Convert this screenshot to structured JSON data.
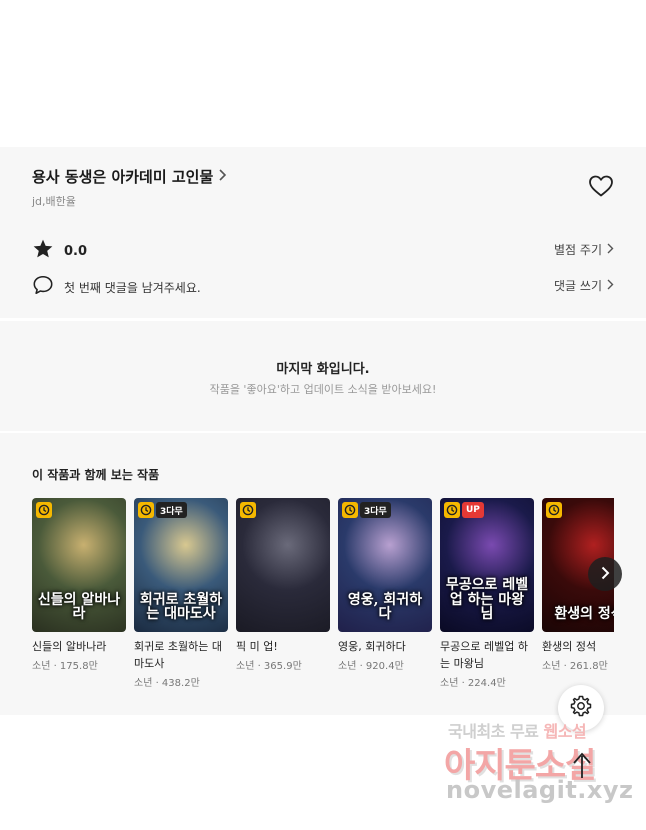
{
  "series": {
    "title": "용사 동생은 아카데미 고인물",
    "author": "jd,배한율"
  },
  "rating": {
    "value": "0.0",
    "rate_label": "별점 주기"
  },
  "comments": {
    "prompt": "첫 번째 댓글을 남겨주세요.",
    "write_label": "댓글 쓰기"
  },
  "last_episode": {
    "title": "마지막 화입니다.",
    "subtitle": "작품을 '좋아요'하고 업데이트 소식을 받아보세요!"
  },
  "recommendations": {
    "heading": "이 작품과 함께 보는 작품",
    "items": [
      {
        "name": "신들의 알바나라",
        "meta": "소년 · 175.8만",
        "badge": "",
        "cover_text": "신들의 알바나라",
        "colors": [
          "#4a5a3a",
          "#c8b070",
          "#2a3020"
        ]
      },
      {
        "name": "회귀로 초월하는 대마도사",
        "meta": "소년 · 438.2만",
        "badge": "3다무",
        "cover_text": "회귀로 초월하는 대마도사",
        "colors": [
          "#3a5a7a",
          "#d8c890",
          "#1a2a40"
        ]
      },
      {
        "name": "픽 미 업!",
        "meta": "소년 · 365.9만",
        "badge": "",
        "cover_text": "",
        "colors": [
          "#2a2a3a",
          "#6a6a7a",
          "#1a1a24"
        ]
      },
      {
        "name": "영웅, 회귀하다",
        "meta": "소년 · 920.4만",
        "badge": "3다무",
        "cover_text": "영웅, 회귀하다",
        "colors": [
          "#2a3a6a",
          "#b8a0d0",
          "#20204a"
        ]
      },
      {
        "name": "무공으로 레벨업 하는 마왕님",
        "meta": "소년 · 224.4만",
        "badge": "UP",
        "cover_text": "무공으로 레벨업 하는 마왕님",
        "colors": [
          "#1a1a4a",
          "#7a4ab0",
          "#0a0a24"
        ]
      },
      {
        "name": "환생의 정석",
        "meta": "소년 · 261.8만",
        "badge": "",
        "cover_text": "환생의 정석",
        "colors": [
          "#3a0a0a",
          "#b02020",
          "#1a0505"
        ]
      }
    ]
  },
  "watermark": {
    "line1_a": "국내최초 무료 ",
    "line1_b": "웹소설",
    "line2": "아지툰소설",
    "line3": "novelagit.xyz"
  },
  "colors": {
    "panel_bg": "#f7f7f7",
    "clock_badge": "#f5b800",
    "up_badge": "#e53935"
  }
}
